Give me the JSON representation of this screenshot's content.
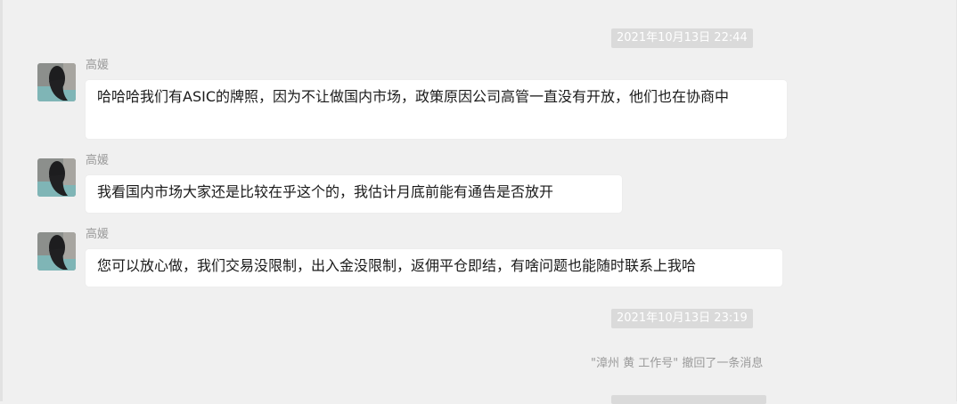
{
  "chat": {
    "timestamps": [
      "2021年10月13日 22:44",
      "2021年10月13日 23:19"
    ],
    "messages": [
      {
        "sender": "高媛",
        "text": "哈哈哈我们有ASIC的牌照，因为不让做国内市场，政策原因公司高管一直没有开放，他们也在协商中"
      },
      {
        "sender": "高媛",
        "text": "我看国内市场大家还是比较在乎这个的，我估计月底前能有通告是否放开"
      },
      {
        "sender": "高媛",
        "text": "您可以放心做，我们交易没限制，出入金没限制，返佣平仓即结，有啥问题也能随时联系上我哈"
      }
    ],
    "recall_notice": "\"漳州 黄 工作号\" 撤回了一条消息",
    "avatar_icon": "avatar-photo-icon"
  }
}
